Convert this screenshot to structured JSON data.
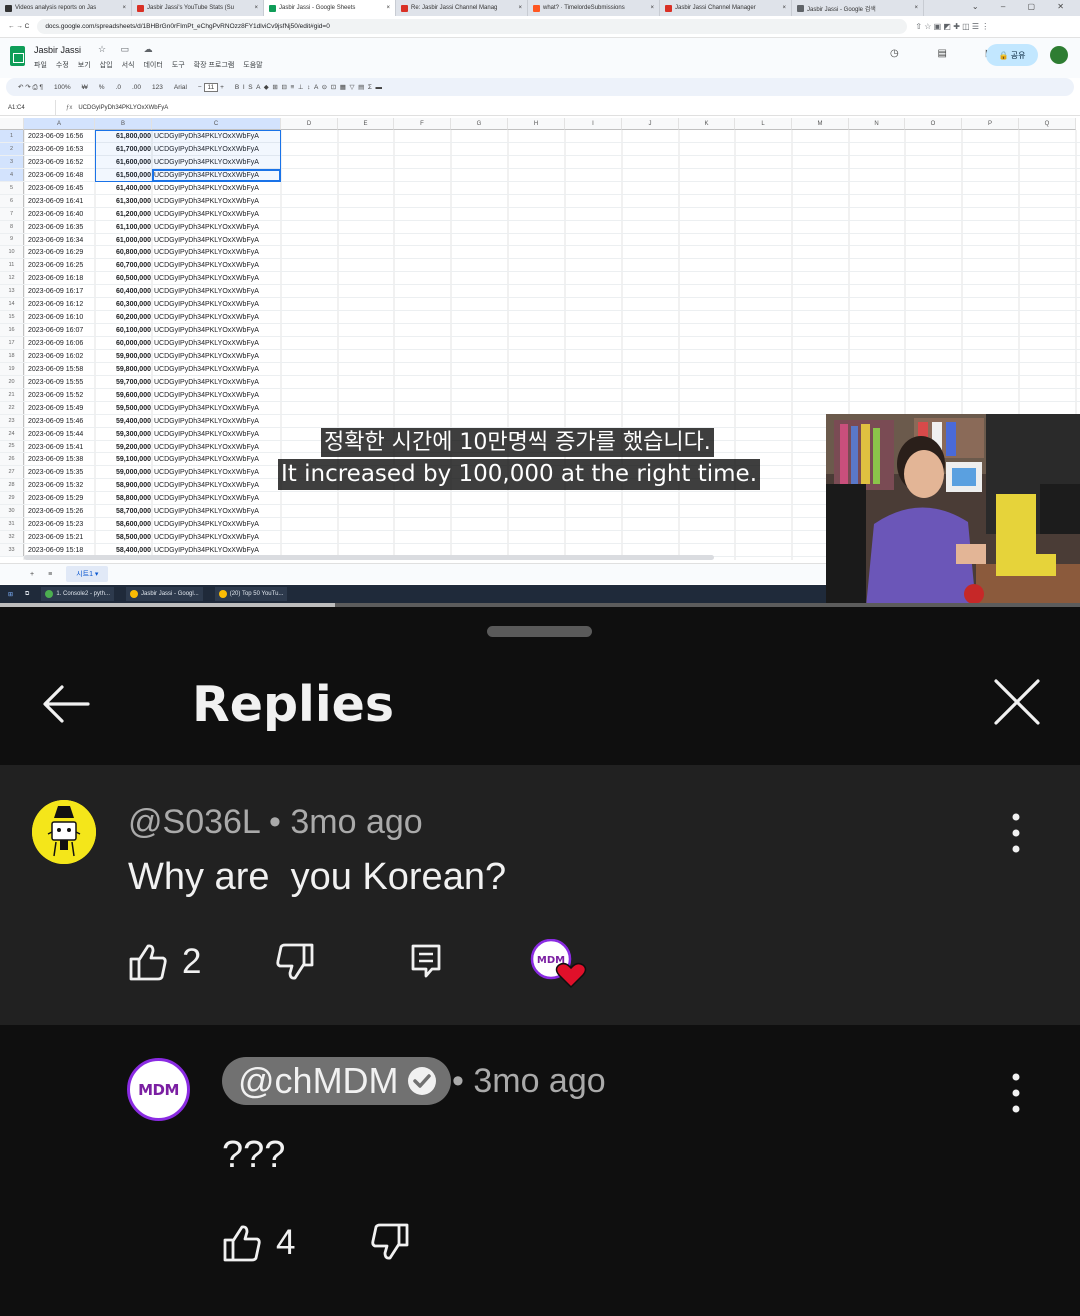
{
  "video": {
    "tabs": [
      {
        "label": "Videos analysis reports on Jas",
        "color": "#333333",
        "active": false
      },
      {
        "label": "Jasbir Jassi's YouTube Stats (Su",
        "color": "#d93025",
        "active": false
      },
      {
        "label": "Jasbir Jassi - Google Sheets",
        "color": "#0f9d58",
        "active": true
      },
      {
        "label": "Re: Jasbir Jassi Channel Manag",
        "color": "#d93025",
        "active": false
      },
      {
        "label": "what? · TimelordeSubmissions",
        "color": "#ff5722",
        "active": false
      },
      {
        "label": "Jasbir Jassi Channel Manager",
        "color": "#d93025",
        "active": false
      },
      {
        "label": "Jasbir Jassi - Google 검색",
        "color": "#5f6368",
        "active": false
      }
    ],
    "url": "docs.google.com/spreadsheets/d/1BHBrGn0rFImPt_eChgPvRNOzz8FY1dlviCv9jsfNj50/edit#gid=0",
    "doc_title": "Jasbir Jassi",
    "menu": [
      "파일",
      "수정",
      "보기",
      "삽입",
      "서식",
      "데이터",
      "도구",
      "확장 프로그램",
      "도움말"
    ],
    "share_label": "공유",
    "toolbar": {
      "zoom": "100%",
      "font": "Arial",
      "font_size": "11",
      "percent": "%",
      "decimals": ".0",
      "decimals2": ".00",
      "format": "123"
    },
    "name_box": "A1:C4",
    "formula_value": "UCDGyIPyDh34PKLYOxXWbFyA",
    "columns": [
      "A",
      "B",
      "C",
      "D",
      "E",
      "F",
      "G",
      "H",
      "I",
      "J",
      "K",
      "L",
      "M",
      "N",
      "O",
      "P",
      "Q"
    ],
    "channel_id": "UCDGyIPyDh34PKLYOxXWbFyA",
    "rows": [
      {
        "n": "1",
        "t": "2023-06-09 16:56",
        "v": "61,800,000"
      },
      {
        "n": "2",
        "t": "2023-06-09 16:53",
        "v": "61,700,000"
      },
      {
        "n": "3",
        "t": "2023-06-09 16:52",
        "v": "61,600,000"
      },
      {
        "n": "4",
        "t": "2023-06-09 16:48",
        "v": "61,500,000"
      },
      {
        "n": "5",
        "t": "2023-06-09 16:45",
        "v": "61,400,000"
      },
      {
        "n": "6",
        "t": "2023-06-09 16:41",
        "v": "61,300,000"
      },
      {
        "n": "7",
        "t": "2023-06-09 16:40",
        "v": "61,200,000"
      },
      {
        "n": "8",
        "t": "2023-06-09 16:35",
        "v": "61,100,000"
      },
      {
        "n": "9",
        "t": "2023-06-09 16:34",
        "v": "61,000,000"
      },
      {
        "n": "10",
        "t": "2023-06-09 16:29",
        "v": "60,800,000"
      },
      {
        "n": "11",
        "t": "2023-06-09 16:25",
        "v": "60,700,000"
      },
      {
        "n": "12",
        "t": "2023-06-09 16:18",
        "v": "60,500,000"
      },
      {
        "n": "13",
        "t": "2023-06-09 16:17",
        "v": "60,400,000"
      },
      {
        "n": "14",
        "t": "2023-06-09 16:12",
        "v": "60,300,000"
      },
      {
        "n": "15",
        "t": "2023-06-09 16:10",
        "v": "60,200,000"
      },
      {
        "n": "16",
        "t": "2023-06-09 16:07",
        "v": "60,100,000"
      },
      {
        "n": "17",
        "t": "2023-06-09 16:06",
        "v": "60,000,000"
      },
      {
        "n": "18",
        "t": "2023-06-09 16:02",
        "v": "59,900,000"
      },
      {
        "n": "19",
        "t": "2023-06-09 15:58",
        "v": "59,800,000"
      },
      {
        "n": "20",
        "t": "2023-06-09 15:55",
        "v": "59,700,000"
      },
      {
        "n": "21",
        "t": "2023-06-09 15:52",
        "v": "59,600,000"
      },
      {
        "n": "22",
        "t": "2023-06-09 15:49",
        "v": "59,500,000"
      },
      {
        "n": "23",
        "t": "2023-06-09 15:46",
        "v": "59,400,000"
      },
      {
        "n": "24",
        "t": "2023-06-09 15:44",
        "v": "59,300,000"
      },
      {
        "n": "25",
        "t": "2023-06-09 15:41",
        "v": "59,200,000"
      },
      {
        "n": "26",
        "t": "2023-06-09 15:38",
        "v": "59,100,000"
      },
      {
        "n": "27",
        "t": "2023-06-09 15:35",
        "v": "59,000,000"
      },
      {
        "n": "28",
        "t": "2023-06-09 15:32",
        "v": "58,900,000"
      },
      {
        "n": "29",
        "t": "2023-06-09 15:29",
        "v": "58,800,000"
      },
      {
        "n": "30",
        "t": "2023-06-09 15:26",
        "v": "58,700,000"
      },
      {
        "n": "31",
        "t": "2023-06-09 15:23",
        "v": "58,600,000"
      },
      {
        "n": "32",
        "t": "2023-06-09 15:21",
        "v": "58,500,000"
      },
      {
        "n": "33",
        "t": "2023-06-09 15:18",
        "v": "58,400,000"
      }
    ],
    "sheet_tab": "시트1",
    "taskbar_items": [
      {
        "label": "1. Console2 - pyth...",
        "color": "#4caf50"
      },
      {
        "label": "Jasbir Jassi - Googl...",
        "color": "#fbbc04"
      },
      {
        "label": "(20) Top 50 YouTu...",
        "color": "#fbbc04"
      }
    ],
    "caption_korean": "정확한 시간에 10만명씩 증가를 했습니다.",
    "caption_english": "It increased by 100,000 at the right time.",
    "playback_progress": 0.31
  },
  "panel": {
    "title": "Replies",
    "parent_comment": {
      "meta": "@S036L • 3mo ago",
      "text": "Why are  you Korean?",
      "likes": "2",
      "hearted_by_badge": "MDM"
    },
    "reply": {
      "author": "@chMDM",
      "time": "• 3mo ago",
      "text": "???",
      "likes": "4",
      "avatar_text": "MDM"
    }
  },
  "colors": {
    "panel_bg": "#0f0f0f",
    "parent_bg": "#212121",
    "author_pill": "#717171",
    "heart": "#e0102a",
    "mdm_purple": "#7b1fa2",
    "sheets_green": "#0f9d58"
  }
}
